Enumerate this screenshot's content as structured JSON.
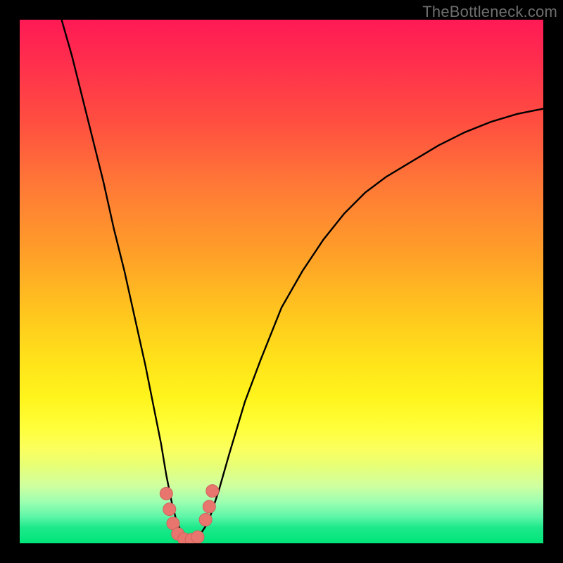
{
  "watermark": "TheBottleneck.com",
  "colors": {
    "background": "#000000",
    "curve_stroke": "#000000",
    "marker_fill": "#e8766f",
    "marker_stroke": "#cf625b",
    "watermark_text": "#6e6e6e"
  },
  "chart_data": {
    "type": "line",
    "title": "",
    "xlabel": "",
    "ylabel": "",
    "xlim": [
      0,
      100
    ],
    "ylim": [
      0,
      100
    ],
    "grid": false,
    "legend": false,
    "series": [
      {
        "name": "curve",
        "x": [
          8,
          10,
          12,
          14,
          16,
          18,
          20,
          22,
          24,
          26,
          27,
          28,
          29,
          30,
          31,
          32,
          33,
          34,
          36,
          38,
          40,
          43,
          46,
          50,
          54,
          58,
          62,
          66,
          70,
          75,
          80,
          85,
          90,
          95,
          100
        ],
        "y": [
          100,
          93,
          85,
          77,
          69,
          60,
          52,
          43,
          34,
          24,
          19,
          13,
          8,
          4,
          2,
          1,
          0.5,
          1,
          4,
          10,
          17,
          27,
          35,
          45,
          52,
          58,
          63,
          67,
          70,
          73,
          76,
          78.5,
          80.5,
          82,
          83
        ]
      }
    ],
    "markers": {
      "name": "highlight-dots",
      "x": [
        28.0,
        28.6,
        29.3,
        30.2,
        31.4,
        32.8,
        34.0,
        35.5,
        36.2,
        36.8
      ],
      "y": [
        9.5,
        6.5,
        3.8,
        1.8,
        0.8,
        0.7,
        1.2,
        4.5,
        7.0,
        10.0
      ]
    }
  }
}
